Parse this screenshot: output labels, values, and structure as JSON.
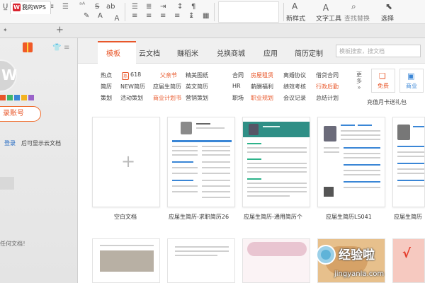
{
  "ribbon": {
    "new_style": "新样式",
    "text_tools": "文字工具",
    "find_replace": "查找替换",
    "select": "选择"
  },
  "tabs": {
    "doc_tab_label": "我的WPS"
  },
  "left_panel": {
    "account_button": "录账号",
    "login_link": "登录",
    "login_tip": "后可显示云文档",
    "empty_tip": "任何文档！"
  },
  "nav": {
    "items": [
      "模板",
      "云文档",
      "赚稻米",
      "兑换商城",
      "应用",
      "简历定制"
    ],
    "search_placeholder": "模板搜索，搜文档"
  },
  "categories": [
    {
      "head": "热点",
      "items": [
        "618",
        "父亲节",
        "精美图纸"
      ]
    },
    {
      "head": "简历",
      "items": [
        "NEW简历",
        "应届生简历",
        "英文简历"
      ]
    },
    {
      "head": "策划",
      "items": [
        "活动策划",
        "商业计划书",
        "营销策划"
      ]
    }
  ],
  "categories_right": [
    {
      "head": "合同",
      "items": [
        "房屋租赁",
        "离婚协议",
        "借贷合同"
      ]
    },
    {
      "head": "HR",
      "items": [
        "薪酬福利",
        "绩效考核",
        "行政后勤"
      ]
    },
    {
      "head": "职场",
      "items": [
        "职业规划",
        "会议记录",
        "总结计划"
      ]
    }
  ],
  "tags": {
    "hot": "热",
    "new": "NEW"
  },
  "more_label": "更多",
  "promo": {
    "free": "免费",
    "business": "商业",
    "caption": "充值月卡送礼包"
  },
  "templates": [
    {
      "caption": "空白文档"
    },
    {
      "caption": "应届生简历-求职简历26"
    },
    {
      "caption": "应届生简历-通用简历个"
    },
    {
      "caption": "应届生简历LS041"
    },
    {
      "caption": "应届生简历"
    }
  ],
  "watermark": {
    "main": "经验啦",
    "sub": "jingyanla.com",
    "mark": "√"
  },
  "colors": {
    "accent": "#e8572a",
    "teal": "#2f8f86",
    "blue": "#3a86d6",
    "red": "#e53b2a"
  }
}
